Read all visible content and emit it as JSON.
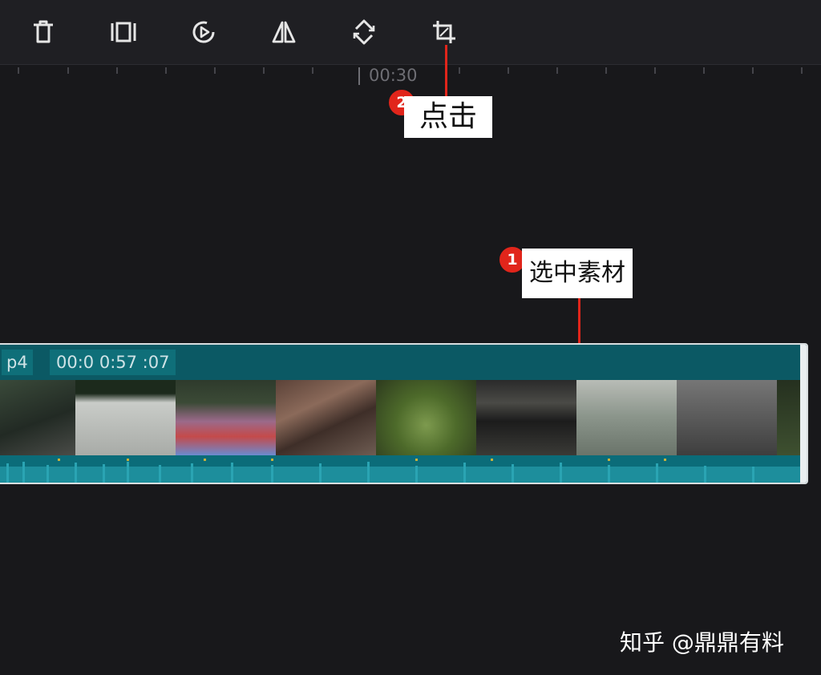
{
  "toolbar": {
    "items": [
      {
        "icon": "delete-icon",
        "label": ""
      },
      {
        "icon": "split-icon",
        "label": ""
      },
      {
        "icon": "playback-speed-icon",
        "label": ""
      },
      {
        "icon": "mirror-icon",
        "label": ""
      },
      {
        "icon": "rotate-icon",
        "label": ""
      },
      {
        "icon": "crop-icon",
        "label": ""
      }
    ]
  },
  "timeline": {
    "ruler_time": "00:30",
    "clip": {
      "name": "p4",
      "duration": "00:0 0:57 :07"
    }
  },
  "annotations": {
    "step1": {
      "number": "1",
      "text": "选中素材"
    },
    "step2": {
      "number": "2",
      "text": "点击"
    }
  },
  "watermark": "知乎 @鼎鼎有料",
  "colors": {
    "accent_red": "#e1251b",
    "clip_teal": "#0c5e68",
    "background": "#18181b"
  }
}
